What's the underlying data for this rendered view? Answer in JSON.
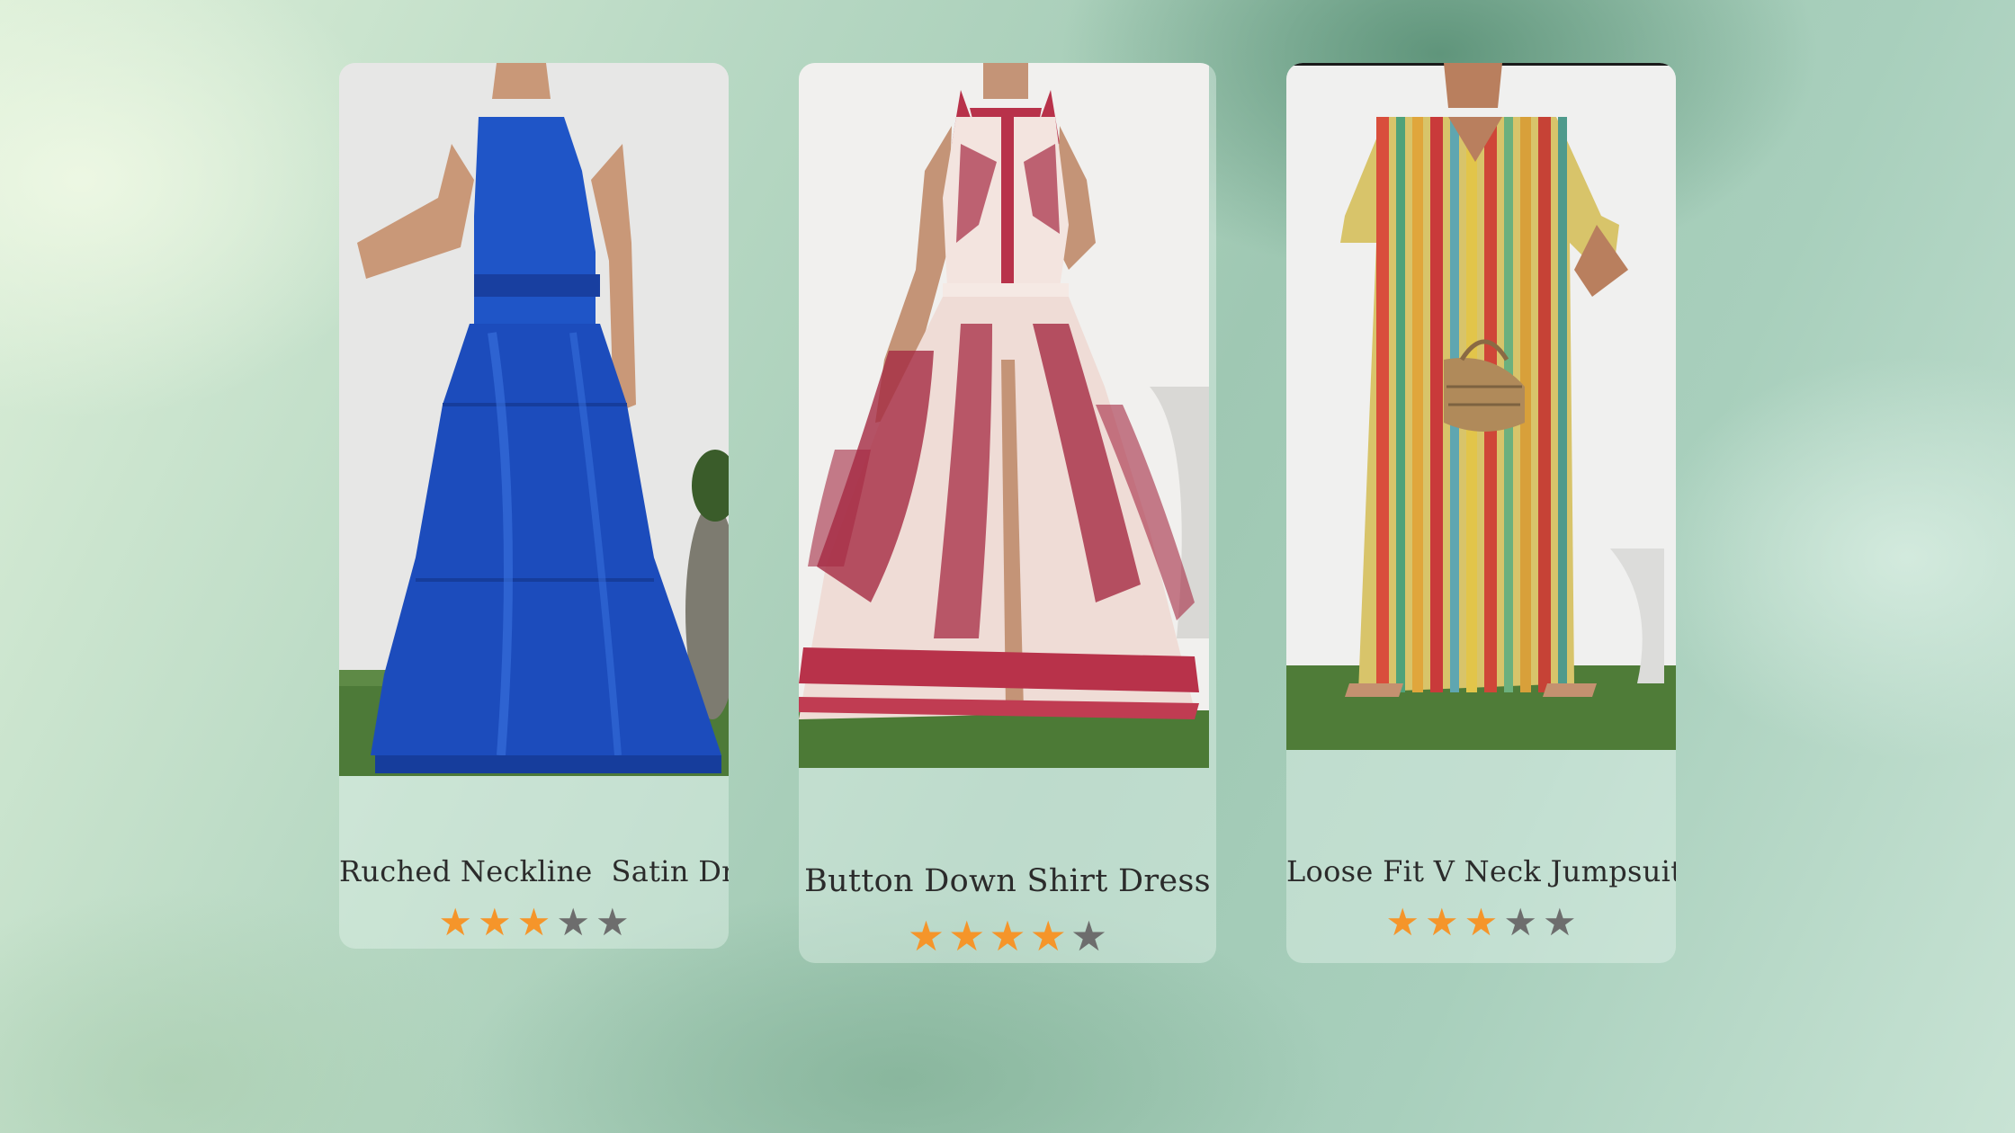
{
  "products": [
    {
      "title": "Ruched Neckline  Satin Dress",
      "image_alt": "Blue satin halter maxi dress",
      "rating": 3,
      "max_rating": 5
    },
    {
      "title": "Button Down Shirt Dress",
      "image_alt": "Red floral button down shirt dress",
      "rating": 4,
      "max_rating": 5
    },
    {
      "title": "Loose Fit V Neck Jumpsuit",
      "image_alt": "Multicolor striped V neck jumpsuit",
      "rating": 3,
      "max_rating": 5
    }
  ],
  "colors": {
    "star_filled": "#f5952a",
    "star_empty": "#6d6d6d",
    "title_text": "#2b2b2b"
  }
}
